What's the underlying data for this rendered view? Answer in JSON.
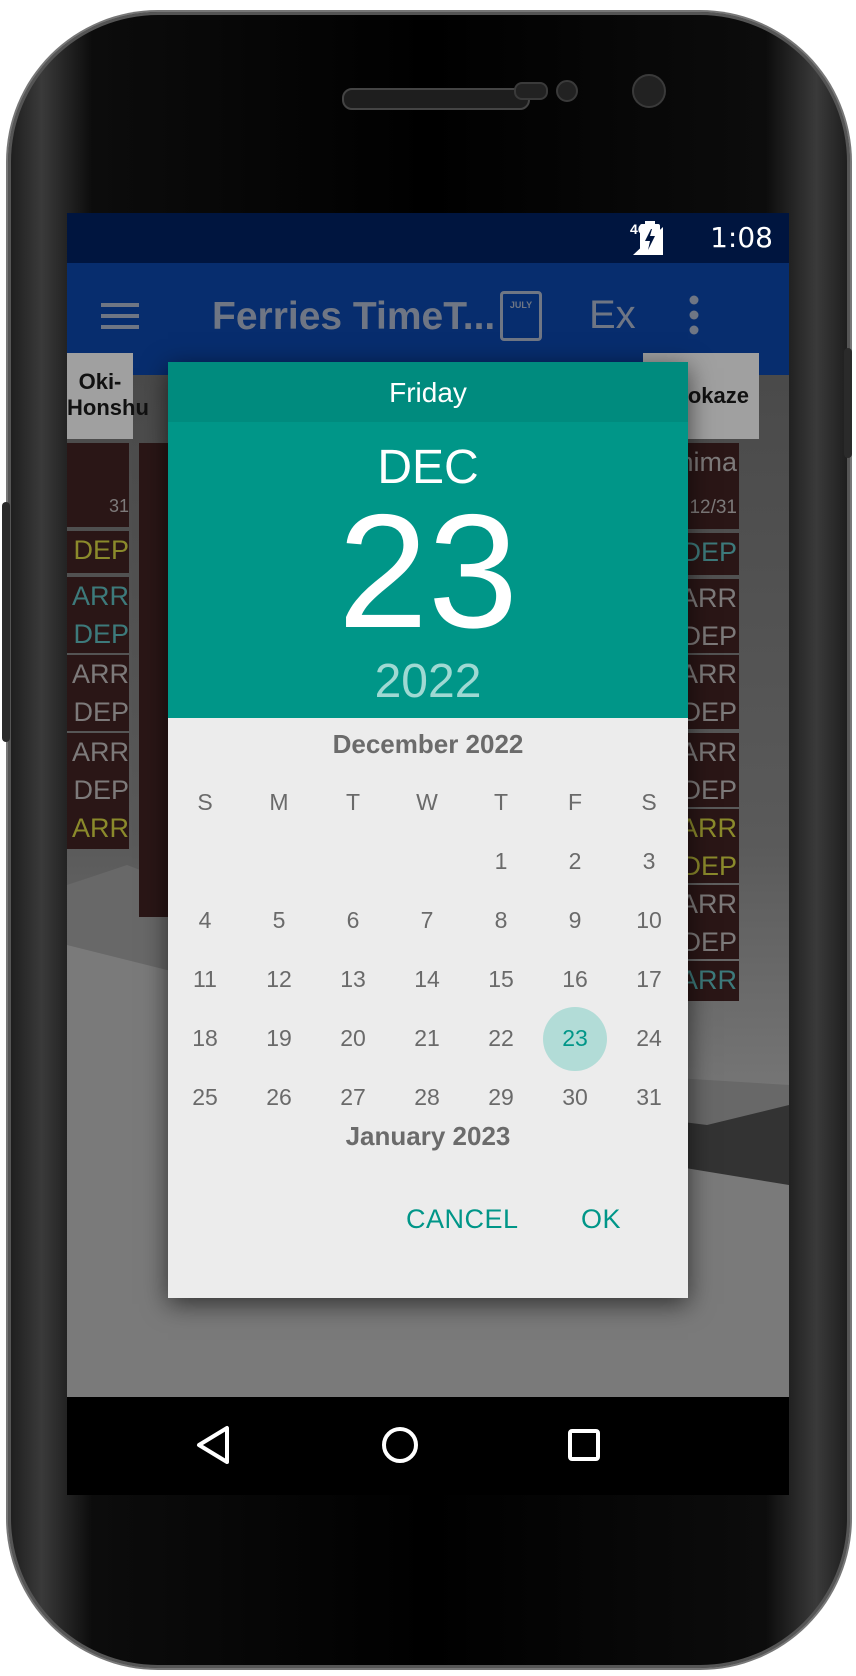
{
  "status": {
    "network": "4G",
    "time": "1:08"
  },
  "appbar": {
    "title": "Ferries TimeT...",
    "calendar_icon_text": "JULY",
    "ex_label": "Ex"
  },
  "columns": {
    "left_header": "Oki-\nHonshu",
    "right_header": "Isokaze"
  },
  "left_cells": [
    {
      "text": "31",
      "color": "gray"
    },
    {
      "text": "DEP",
      "color": "yellow"
    },
    {
      "text": "ARR\nDEP",
      "color": "teal"
    },
    {
      "text": "ARR\nDEP",
      "color": "gray"
    },
    {
      "text": "ARR\nDEP",
      "color": "gray"
    },
    {
      "text": "ARR",
      "color": "yellow"
    }
  ],
  "right_cells": [
    {
      "text": "shima",
      "color": "gray"
    },
    {
      "text": "12/31",
      "color": "gray"
    },
    {
      "text": "30DEP",
      "color": "teal"
    },
    {
      "text": "40ARR\n50DEP",
      "color": "gray"
    },
    {
      "text": "05ARR\n20DEP",
      "color": "gray"
    },
    {
      "text": "50ARR\n55DEP",
      "color": "gray"
    },
    {
      "text": "20ARR\n25DEP",
      "color": "yellow"
    },
    {
      "text": "05ARR\n15DEP",
      "color": "gray"
    },
    {
      "text": "30ARR",
      "color": "teal"
    }
  ],
  "dialog": {
    "weekday": "Friday",
    "month": "DEC",
    "day": "23",
    "year": "2022",
    "calendar_title": "December 2022",
    "weekday_headers": [
      "S",
      "M",
      "T",
      "W",
      "T",
      "F",
      "S"
    ],
    "weeks": [
      [
        "",
        "",
        "",
        "",
        "1",
        "2",
        "3"
      ],
      [
        "4",
        "5",
        "6",
        "7",
        "8",
        "9",
        "10"
      ],
      [
        "11",
        "12",
        "13",
        "14",
        "15",
        "16",
        "17"
      ],
      [
        "18",
        "19",
        "20",
        "21",
        "22",
        "23",
        "24"
      ],
      [
        "25",
        "26",
        "27",
        "28",
        "29",
        "30",
        "31"
      ]
    ],
    "selected_day": "23",
    "next_month_title": "January 2023",
    "cancel_label": "CANCEL",
    "ok_label": "OK"
  },
  "colors": {
    "accent": "#009688",
    "header_dark": "#008b7e",
    "appbar": "#072d6e",
    "statusbar": "#00153f"
  }
}
